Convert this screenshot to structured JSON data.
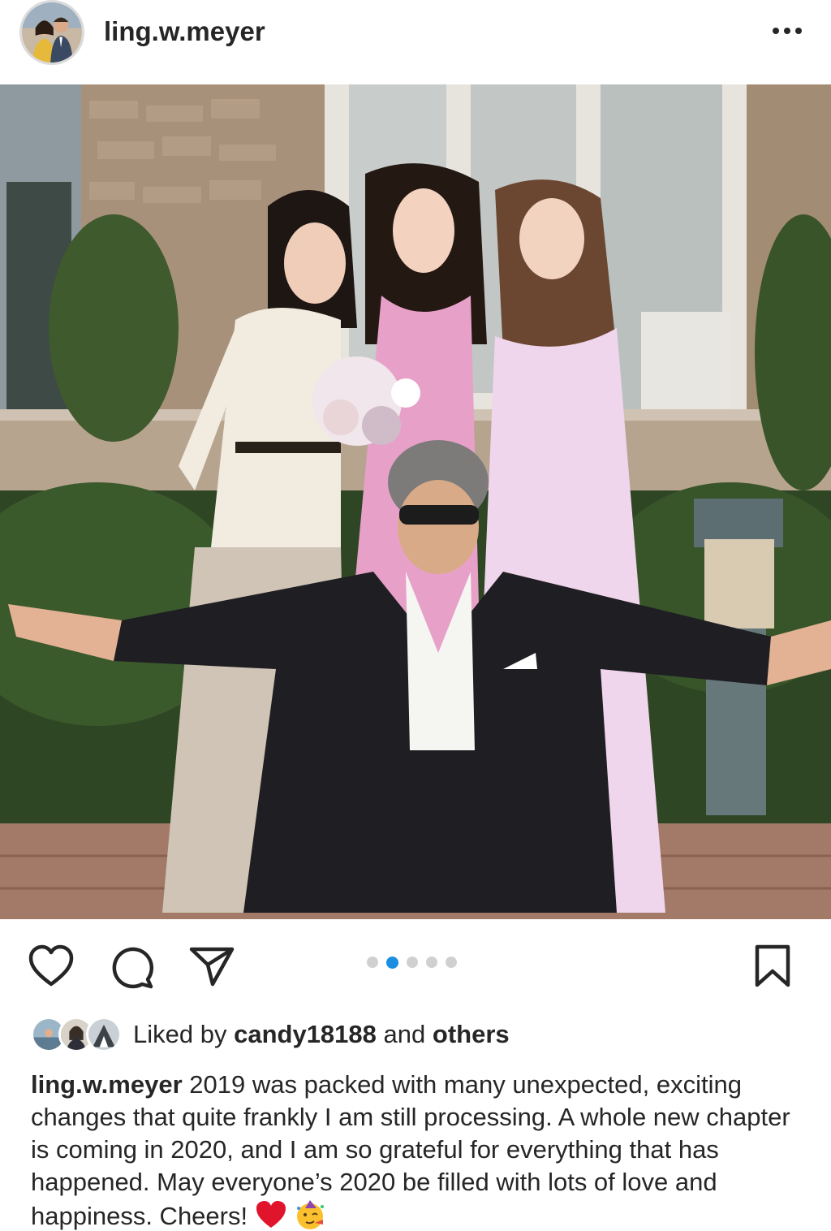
{
  "post": {
    "username": "ling.w.meyer",
    "more_icon": "more-horizontal-icon",
    "carousel": {
      "count": 5,
      "active_index": 1
    },
    "actions": [
      "heart-icon",
      "comment-icon",
      "share-icon",
      "bookmark-icon"
    ]
  },
  "likes": {
    "prefix": "Liked by",
    "user": "candy18188",
    "middle": "and",
    "suffix": "others"
  },
  "caption": {
    "username": "ling.w.meyer",
    "text": "2019 was packed with many unexpected, exciting changes that quite frankly I am still processing. A whole new chapter is coming in 2020, and I am so grateful for everything that has happened. May everyone’s 2020 be filled with lots of love and happiness. Cheers!",
    "emojis": [
      "red-heart-emoji",
      "partying-face-emoji"
    ]
  },
  "colors": {
    "text": "#262626",
    "active_dot": "#1a8ee0",
    "inactive_dot": "#d0d0d0"
  }
}
